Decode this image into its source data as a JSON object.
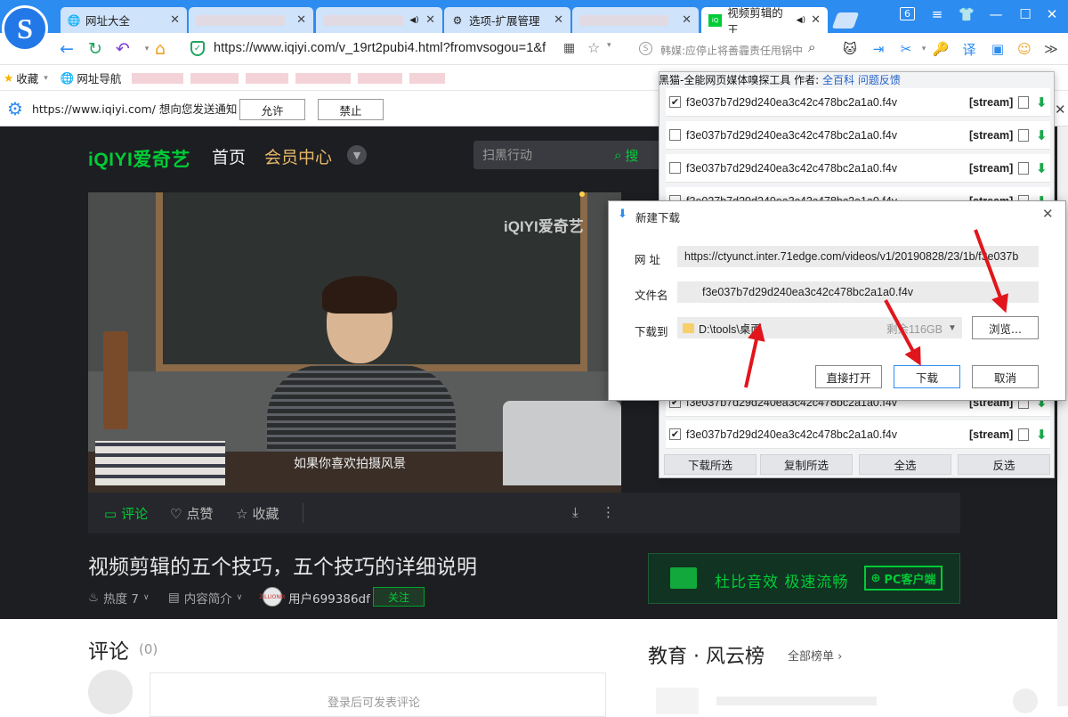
{
  "browser": {
    "logo_letter": "S",
    "tabs": [
      {
        "title": "网址大全",
        "icon": "globe-icon",
        "active": false
      },
      {
        "title": "",
        "icon": "",
        "active": false
      },
      {
        "title": "",
        "icon": "speaker-icon",
        "active": false
      },
      {
        "title": "选项-扩展管理",
        "icon": "gear-icon",
        "active": false
      },
      {
        "title": "",
        "icon": "",
        "active": false
      },
      {
        "title": "视频剪辑的王",
        "icon": "iqiyi-icon",
        "active": true
      }
    ],
    "tab_count": "6",
    "address": "https://www.iqiyi.com/v_19rt2pubi4.html?fromvsogou=1&f",
    "news_ticker": "韩媒:应停止将善霾责任甩锅中",
    "bookmarks": {
      "favorites": "收藏",
      "nav": "网址导航"
    },
    "notification": {
      "text": "https://www.iqiyi.com/ 想向您发送通知",
      "allow": "允许",
      "block": "禁止"
    }
  },
  "site": {
    "logo": "iQIYI爱奇艺",
    "nav": {
      "home": "首页",
      "vip": "会员中心"
    },
    "search": {
      "placeholder": "扫黑行动",
      "button": "搜"
    },
    "video": {
      "watermark": "iQIYI爱奇艺",
      "subtitle": "如果你喜欢拍摄风景"
    },
    "actions": {
      "comment": "评论",
      "like": "点赞",
      "favorite": "收藏"
    },
    "title": "视频剪辑的五个技巧，五个技巧的详细说明",
    "meta": {
      "heat": "热度 7",
      "intro": "内容简介",
      "user": "用户699386df",
      "avatar_text": "ZILLIONIX",
      "follow": "关注"
    },
    "promo": {
      "text": "杜比音效  极速流畅",
      "pc": "PC客户端"
    },
    "comments": {
      "title": "评论",
      "count": "(0)",
      "hint": "登录后可发表评论"
    },
    "ranking": {
      "title": "教育 · 风云榜",
      "all": "全部榜单 ›"
    }
  },
  "extension": {
    "title": "黑猫-全能网页媒体嗅探工具",
    "author_label": "作者:",
    "author_link": "全百科",
    "feedback": "问题反馈",
    "rows": [
      {
        "name": "f3e037b7d29d240ea3c42c478bc2a1a0.f4v",
        "tag": "[stream]",
        "checked": true
      },
      {
        "name": "f3e037b7d29d240ea3c42c478bc2a1a0.f4v",
        "tag": "[stream]",
        "checked": false
      },
      {
        "name": "f3e037b7d29d240ea3c42c478bc2a1a0.f4v",
        "tag": "[stream]",
        "checked": false
      },
      {
        "name": "f3e037b7d29d240ea3c42c478bc2a1a0.f4v",
        "tag": "[stream]",
        "checked": false
      },
      {
        "name": "f3e037b7d29d240ea3c42c478bc2a1a0.f4v",
        "tag": "[stream]",
        "checked": true
      },
      {
        "name": "f3e037b7d29d240ea3c42c478bc2a1a0.f4v",
        "tag": "[stream]",
        "checked": true
      }
    ],
    "buttons": {
      "download_selected": "下载所选",
      "copy_selected": "复制所选",
      "select_all": "全选",
      "invert": "反选"
    }
  },
  "dialog": {
    "title": "新建下载",
    "url_label": "网 址",
    "url_value": "https://ctyunct.inter.71edge.com/videos/v1/20190828/23/1b/f3e037b",
    "filename_label": "文件名",
    "filename_value": "f3e037b7d29d240ea3c42c478bc2a1a0.f4v",
    "saveto_label": "下载到",
    "saveto_value": "D:\\tools\\桌面",
    "free_space": "剩余116GB",
    "browse": "浏览...",
    "open_direct": "直接打开",
    "download": "下载",
    "cancel": "取消"
  },
  "colors": {
    "browser_blue": "#2d8cf0",
    "iqiyi_green": "#00cc36",
    "annotation_red": "#e0161c"
  }
}
